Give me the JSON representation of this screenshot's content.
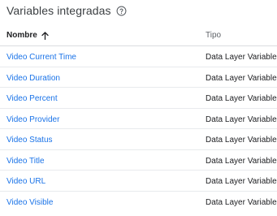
{
  "header": {
    "title": "Variables integradas",
    "help_icon": "help-circle-outline-icon"
  },
  "table": {
    "columns": {
      "name": "Nombre",
      "type": "Tipo",
      "sort_icon": "arrow-upward-icon"
    },
    "rows": [
      {
        "name": "Video Current Time",
        "type": "Data Layer Variable"
      },
      {
        "name": "Video Duration",
        "type": "Data Layer Variable"
      },
      {
        "name": "Video Percent",
        "type": "Data Layer Variable"
      },
      {
        "name": "Video Provider",
        "type": "Data Layer Variable"
      },
      {
        "name": "Video Status",
        "type": "Data Layer Variable"
      },
      {
        "name": "Video Title",
        "type": "Data Layer Variable"
      },
      {
        "name": "Video URL",
        "type": "Data Layer Variable"
      },
      {
        "name": "Video Visible",
        "type": "Data Layer Variable"
      }
    ]
  },
  "colors": {
    "link": "#1a73e8",
    "text": "#202124",
    "muted": "#5f6368",
    "divider": "#dadce0"
  }
}
